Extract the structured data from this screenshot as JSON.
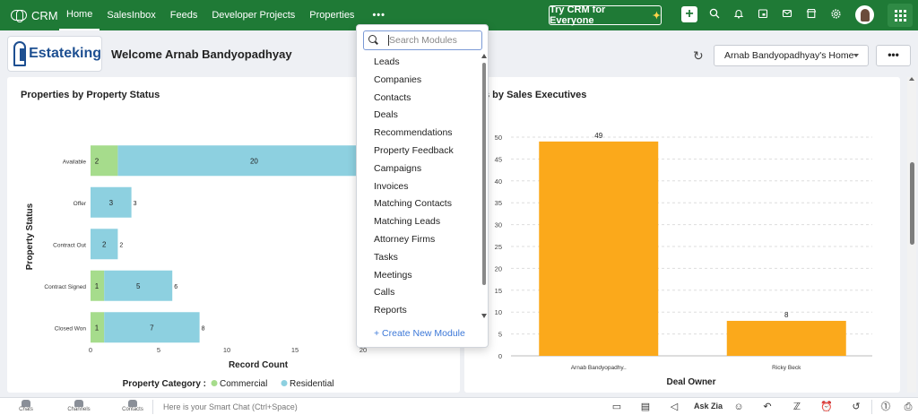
{
  "topbar": {
    "brand": "CRM",
    "nav": [
      {
        "label": "Home",
        "active": true
      },
      {
        "label": "SalesInbox",
        "active": false
      },
      {
        "label": "Feeds",
        "active": false
      },
      {
        "label": "Developer Projects",
        "active": false
      },
      {
        "label": "Properties",
        "active": false
      },
      {
        "label": "•••",
        "active": false
      }
    ],
    "try_button": "Try CRM for Everyone",
    "icons": [
      "plus-icon",
      "search-icon",
      "bell-icon",
      "calendar-icon",
      "mail-icon",
      "marketplace-icon",
      "gear-icon",
      "avatar",
      "apps-grid-icon"
    ],
    "brand_color": "#1f7a36"
  },
  "header": {
    "logo_text": "Estateking",
    "welcome": "Welcome Arnab Bandyopadhyay",
    "home_select": "Arnab Bandyopadhyay's Home",
    "more_label": "•••"
  },
  "card1": {
    "title": "Properties by Property Status"
  },
  "card2": {
    "title": "s by Sales Executives"
  },
  "modules_dropdown": {
    "search_placeholder": "Search Modules",
    "items": [
      "Leads",
      "Companies",
      "Contacts",
      "Deals",
      "Recommendations",
      "Property Feedback",
      "Campaigns",
      "Invoices",
      "Matching Contacts",
      "Matching Leads",
      "Attorney Firms",
      "Tasks",
      "Meetings",
      "Calls",
      "Reports"
    ],
    "create_link": "+ Create New Module"
  },
  "chart_data": [
    {
      "type": "bar",
      "orientation": "horizontal",
      "stacked": true,
      "title": "Properties by Property Status",
      "categories": [
        "Available",
        "Offer",
        "Contract Out",
        "Contract Signed",
        "Closed Won"
      ],
      "series": [
        {
          "name": "Commercial",
          "values": [
            2,
            0,
            0,
            1,
            1
          ],
          "color": "#a6dc8c"
        },
        {
          "name": "Residential",
          "values": [
            20,
            3,
            2,
            5,
            7
          ],
          "color": "#8dd0e0"
        }
      ],
      "totals": [
        22,
        3,
        2,
        6,
        8
      ],
      "xlabel": "Record Count",
      "ylabel": "Property Status",
      "x_ticks": [
        0,
        5,
        10,
        15,
        20
      ],
      "xlim": [
        0,
        20
      ],
      "legend_title": "Property Category :",
      "legend_position": "bottom"
    },
    {
      "type": "bar",
      "title": "s by Sales Executives",
      "categories": [
        "Arnab Bandyopadhy..",
        "Ricky Beck"
      ],
      "values": [
        49,
        8
      ],
      "xlabel": "Deal Owner",
      "y_ticks": [
        0,
        5,
        10,
        15,
        20,
        25,
        30,
        35,
        40,
        45,
        50
      ],
      "ylim": [
        0,
        50
      ],
      "bar_color": "#fba91b",
      "grid": true
    }
  ],
  "bottombar": {
    "items": [
      "Chats",
      "Channels",
      "Contacts"
    ],
    "smart_chat_placeholder": "Here is your Smart Chat (Ctrl+Space)",
    "ask_zia": "Ask Zia"
  }
}
